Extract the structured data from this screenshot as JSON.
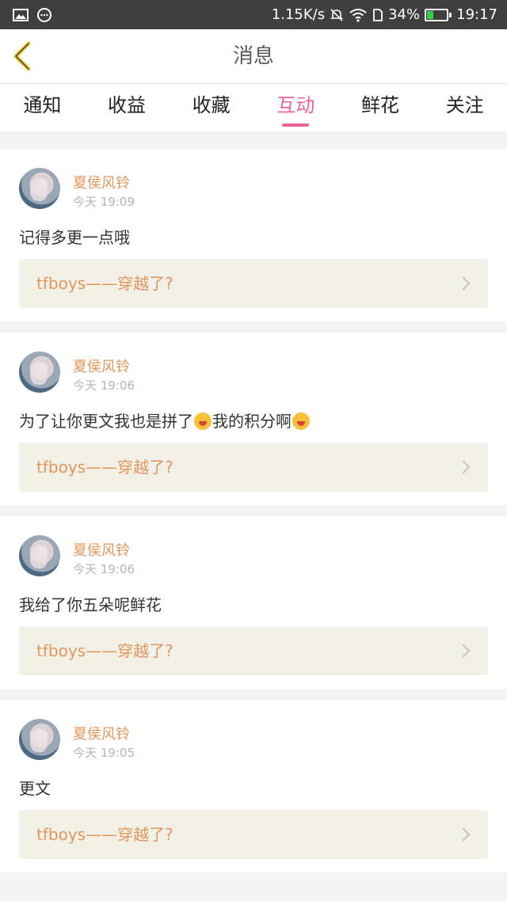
{
  "status_bar": {
    "network_speed": "1.15K/s",
    "battery_percent": "34%",
    "battery_level": 0.34,
    "time": "19:17",
    "icons": [
      "image-icon",
      "chat-bubble-icon",
      "mute-icon",
      "wifi-icon",
      "sim-icon",
      "battery-icon"
    ]
  },
  "header": {
    "title": "消息",
    "back_icon": "chevron-left-icon"
  },
  "tabs": [
    "通知",
    "收益",
    "收藏",
    "互动",
    "鲜花",
    "关注"
  ],
  "active_tab": "互动",
  "colors": {
    "accent_pink": "#e8649a",
    "username_orange": "#e3965c",
    "link_bg": "#f2f1e8",
    "status_bar_bg": "#3f3f3f"
  },
  "messages": [
    {
      "user": "夏侯风铃",
      "time": "今天 19:09",
      "text": "记得多更一点哦",
      "text_after": "",
      "link": "tfboys——穿越了?"
    },
    {
      "user": "夏侯风铃",
      "time": "今天 19:06",
      "text": "为了让你更文我也是拼了",
      "text_after": "我的积分啊",
      "link": "tfboys——穿越了?"
    },
    {
      "user": "夏侯风铃",
      "time": "今天 19:06",
      "text": "我给了你五朵呢鲜花",
      "text_after": "",
      "link": "tfboys——穿越了?"
    },
    {
      "user": "夏侯风铃",
      "time": "今天 19:05",
      "text": "更文",
      "text_after": "",
      "link": "tfboys——穿越了?"
    }
  ]
}
